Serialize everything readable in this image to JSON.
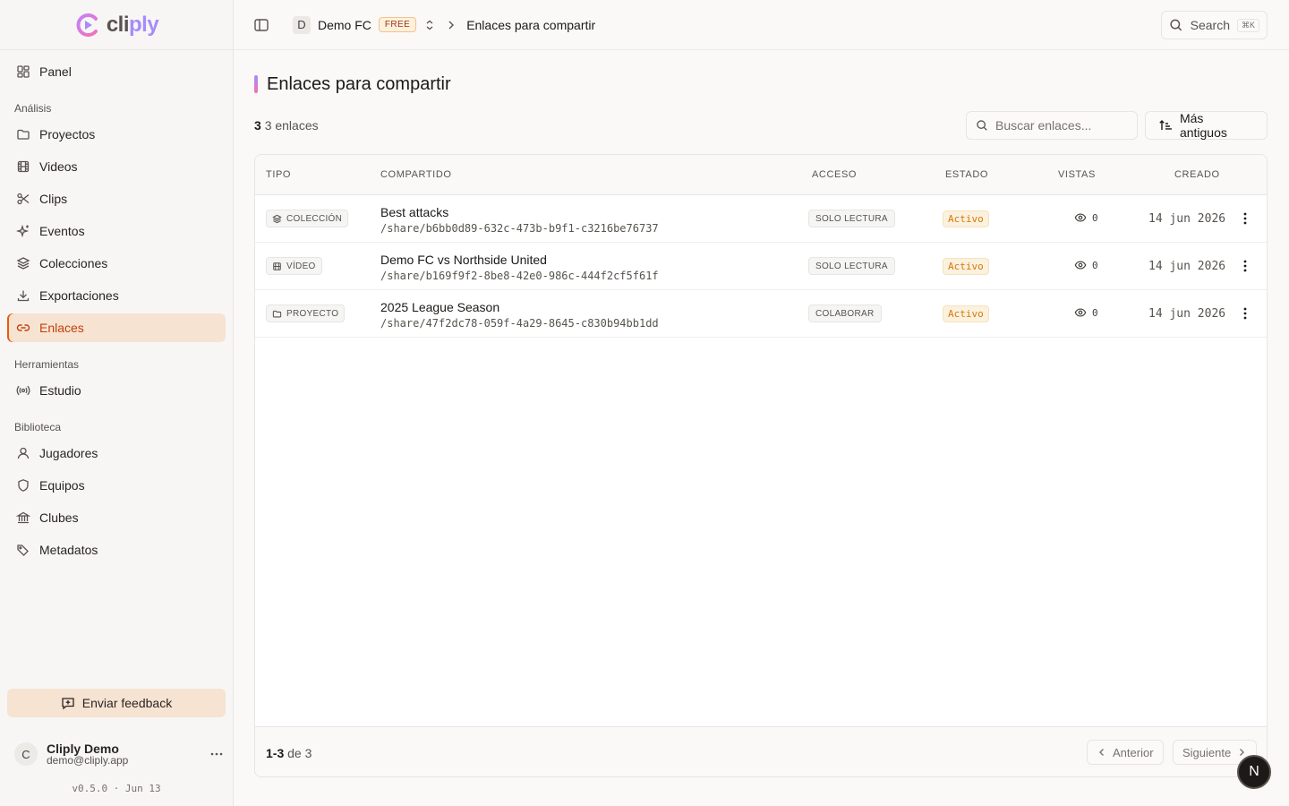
{
  "app": {
    "logo_text_a": "cli",
    "logo_text_b": "ply"
  },
  "sidebar": {
    "top_items": [
      {
        "label": "Panel",
        "icon": "dashboard-icon"
      }
    ],
    "sections": [
      {
        "label": "Análisis",
        "items": [
          {
            "label": "Proyectos",
            "icon": "folder-icon"
          },
          {
            "label": "Videos",
            "icon": "film-icon"
          },
          {
            "label": "Clips",
            "icon": "scissors-icon"
          },
          {
            "label": "Eventos",
            "icon": "sparkles-icon"
          },
          {
            "label": "Colecciones",
            "icon": "layers-icon"
          },
          {
            "label": "Exportaciones",
            "icon": "download-icon"
          },
          {
            "label": "Enlaces",
            "icon": "link-icon",
            "active": true
          }
        ]
      },
      {
        "label": "Herramientas",
        "items": [
          {
            "label": "Estudio",
            "icon": "broadcast-icon"
          }
        ]
      },
      {
        "label": "Biblioteca",
        "items": [
          {
            "label": "Jugadores",
            "icon": "user-icon"
          },
          {
            "label": "Equipos",
            "icon": "shield-icon"
          },
          {
            "label": "Clubes",
            "icon": "bank-icon"
          },
          {
            "label": "Metadatos",
            "icon": "tags-icon"
          }
        ]
      }
    ],
    "feedback_label": "Enviar feedback",
    "user": {
      "initial": "C",
      "name": "Cliply Demo",
      "email": "demo@cliply.app"
    },
    "version": "v0.5.0 · Jun 13"
  },
  "topbar": {
    "org_initial": "D",
    "org_name": "Demo FC",
    "plan": "FREE",
    "breadcrumb_current": "Enlaces para compartir",
    "search_label": "Search",
    "search_shortcut": "⌘K"
  },
  "page": {
    "title": "Enlaces para compartir",
    "count_number": "3",
    "count_text": "3 enlaces",
    "search_placeholder": "Buscar enlaces...",
    "sort_label": "Más antiguos"
  },
  "table": {
    "headers": {
      "type": "TIPO",
      "shared": "COMPARTIDO",
      "access": "ACCESO",
      "status": "ESTADO",
      "views": "VISTAS",
      "created": "CREADO"
    },
    "rows": [
      {
        "type": "COLECCIÓN",
        "type_icon": "layers-icon",
        "name": "Best attacks",
        "path": "/share/b6bb0d89-632c-473b-b9f1-c3216be76737",
        "access": "SOLO LECTURA",
        "status": "Activo",
        "views": "0",
        "created": "14 jun 2026"
      },
      {
        "type": "VÍDEO",
        "type_icon": "film-icon",
        "name": "Demo FC vs Northside United",
        "path": "/share/b169f9f2-8be8-42e0-986c-444f2cf5f61f",
        "access": "SOLO LECTURA",
        "status": "Activo",
        "views": "0",
        "created": "14 jun 2026"
      },
      {
        "type": "PROYECTO",
        "type_icon": "folder-icon",
        "name": "2025 League Season",
        "path": "/share/47f2dc78-059f-4a29-8645-c830b94bb1dd",
        "access": "COLABORAR",
        "status": "Activo",
        "views": "0",
        "created": "14 jun 2026"
      }
    ],
    "footer": {
      "range": "1-3",
      "of_text": "de 3",
      "prev_label": "Anterior",
      "next_label": "Siguiente"
    }
  },
  "fab": {
    "label": "N"
  },
  "colors": {
    "accent": "#ea580c",
    "active_bg": "#f7e3d2",
    "status_active": "#d97706",
    "logo_purple": "#a78bfa"
  }
}
